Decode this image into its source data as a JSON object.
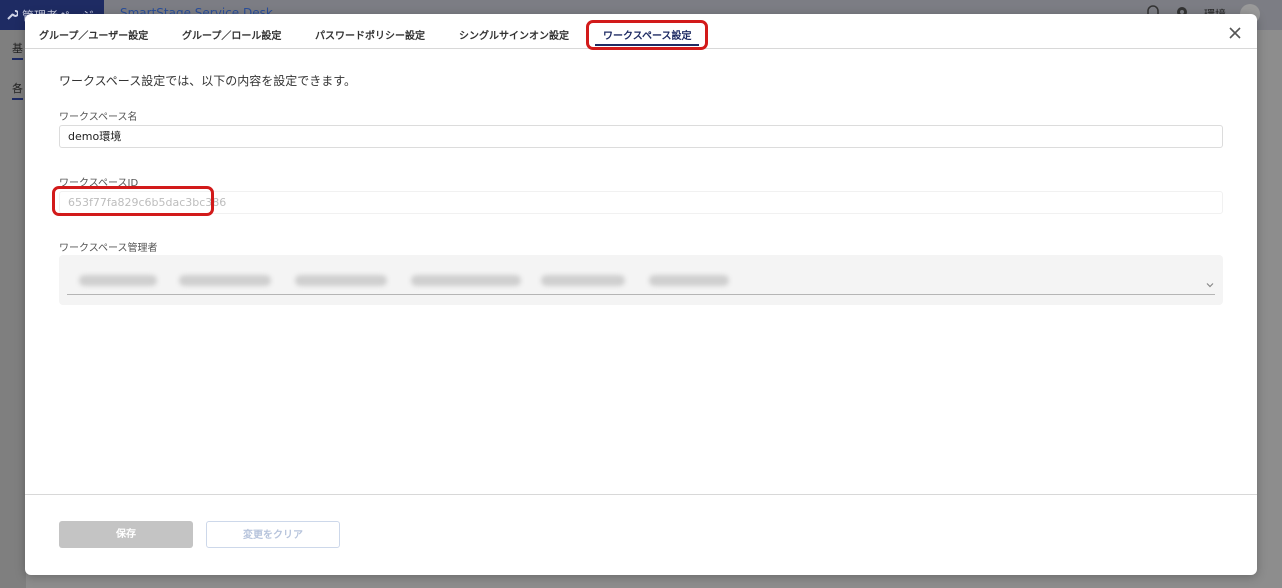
{
  "app": {
    "brand_label": "管理者ページ",
    "app_name": "SmartStage Service Desk",
    "user_label": "環境",
    "left_tab_1": "基",
    "left_tab_2": "各"
  },
  "modal": {
    "tabs": [
      {
        "label": "グループ／ユーザー設定",
        "active": false
      },
      {
        "label": "グループ／ロール設定",
        "active": false
      },
      {
        "label": "パスワードポリシー設定",
        "active": false
      },
      {
        "label": "シングルサインオン設定",
        "active": false
      },
      {
        "label": "ワークスペース設定",
        "active": true
      }
    ],
    "close_icon": "close-icon",
    "intro": "ワークスペース設定では、以下の内容を設定できます。",
    "fields": {
      "workspace_name": {
        "label": "ワークスペース名",
        "value": "demo環境"
      },
      "workspace_id": {
        "label": "ワークスペースID",
        "value": "653f77fa829c6b5dac3bc386"
      },
      "workspace_admin": {
        "label": "ワークスペース管理者"
      }
    },
    "buttons": {
      "save": "保存",
      "clear": "変更をクリア"
    }
  },
  "colors": {
    "accent": "#1e2b63",
    "highlight": "#d21a1a"
  }
}
